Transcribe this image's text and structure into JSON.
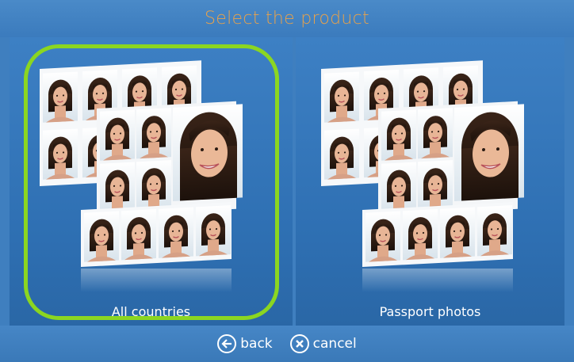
{
  "header": {
    "title": "Select the product"
  },
  "products": [
    {
      "label": "All countries",
      "selected": true
    },
    {
      "label": "Passport photos",
      "selected": false
    }
  ],
  "footer": {
    "back_label": "back",
    "cancel_label": "cancel"
  },
  "colors": {
    "background": "#3f7fbf",
    "title": "#e9a24a",
    "selection": "#8bd621"
  },
  "icons": {
    "back": "arrow-left-circle-icon",
    "cancel": "close-circle-icon"
  }
}
